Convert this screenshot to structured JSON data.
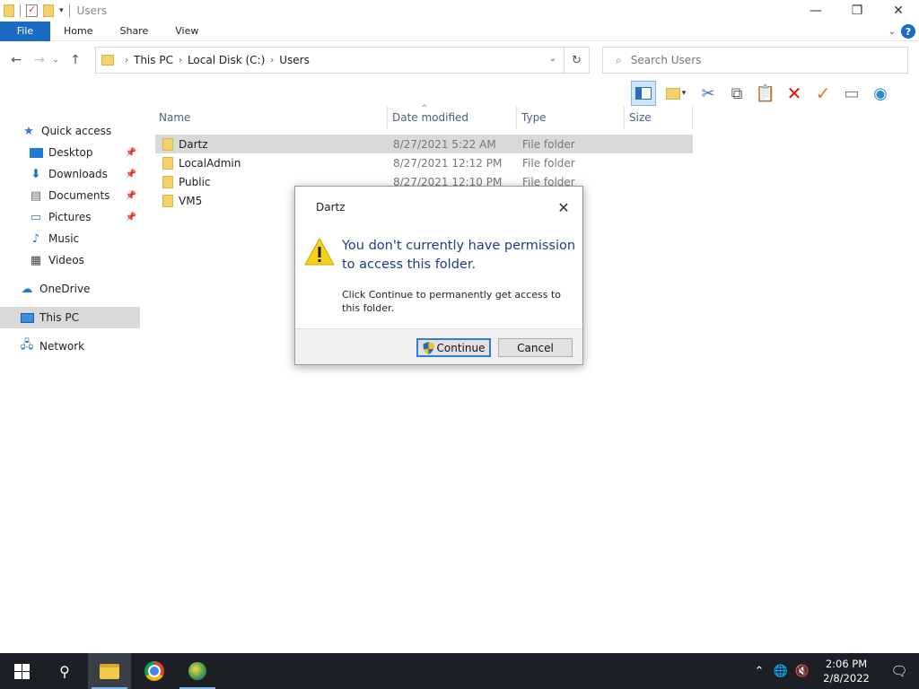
{
  "window": {
    "title": "Users",
    "controls": {
      "minimize": "—",
      "maximize": "❐",
      "close": "✕"
    }
  },
  "ribbon": {
    "tabs": [
      "File",
      "Home",
      "Share",
      "View"
    ],
    "help": "?"
  },
  "address": {
    "crumbs": [
      "This PC",
      "Local Disk (C:)",
      "Users"
    ],
    "search_placeholder": "Search Users"
  },
  "sidebar": {
    "items": [
      {
        "label": "Quick access",
        "icon": "star-icon",
        "pinned": false
      },
      {
        "label": "Desktop",
        "icon": "desktop-icon",
        "pinned": true
      },
      {
        "label": "Downloads",
        "icon": "downloads-icon",
        "pinned": true
      },
      {
        "label": "Documents",
        "icon": "documents-icon",
        "pinned": true
      },
      {
        "label": "Pictures",
        "icon": "pictures-icon",
        "pinned": true
      },
      {
        "label": "Music",
        "icon": "music-icon",
        "pinned": false
      },
      {
        "label": "Videos",
        "icon": "videos-icon",
        "pinned": false
      },
      {
        "label": "OneDrive",
        "icon": "onedrive-icon",
        "pinned": false
      },
      {
        "label": "This PC",
        "icon": "this-pc-icon",
        "pinned": false,
        "selected": true
      },
      {
        "label": "Network",
        "icon": "network-icon",
        "pinned": false
      }
    ]
  },
  "file_list": {
    "columns": [
      "Name",
      "Date modified",
      "Type",
      "Size"
    ],
    "rows": [
      {
        "name": "Dartz",
        "date": "8/27/2021 5:22 AM",
        "type": "File folder",
        "selected": true
      },
      {
        "name": "LocalAdmin",
        "date": "8/27/2021 12:12 PM",
        "type": "File folder"
      },
      {
        "name": "Public",
        "date": "8/27/2021 12:10 PM",
        "type": "File folder"
      },
      {
        "name": "VM5",
        "date": "",
        "type": ""
      }
    ]
  },
  "dialog": {
    "title": "Dartz",
    "main_text": "You don't currently have permission to access this folder.",
    "sub_text": "Click Continue to permanently get access to this folder.",
    "continue_label": "Continue",
    "cancel_label": "Cancel"
  },
  "taskbar": {
    "time": "2:06 PM",
    "date": "2/8/2022"
  }
}
